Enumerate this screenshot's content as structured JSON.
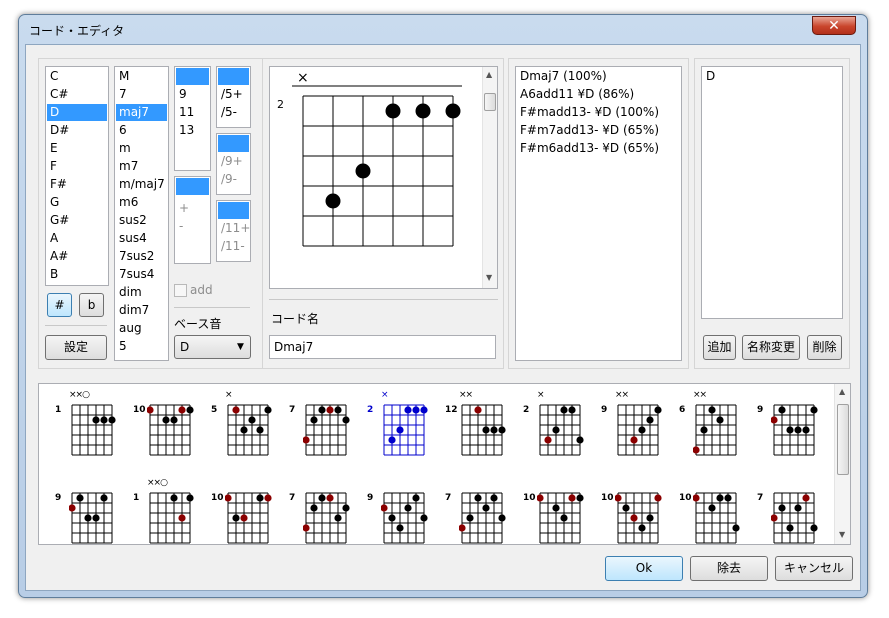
{
  "window": {
    "title": "コード・エディタ",
    "close_glyph": "✕"
  },
  "roots": [
    "C",
    "C#",
    "D",
    "D#",
    "E",
    "F",
    "F#",
    "G",
    "G#",
    "A",
    "A#",
    "B"
  ],
  "selected_root": 2,
  "qualities": [
    "M",
    "7",
    "maj7",
    "6",
    "m",
    "m7",
    "m/maj7",
    "m6",
    "sus2",
    "sus4",
    "7sus2",
    "7sus4",
    "dim",
    "dim7",
    "aug",
    "5"
  ],
  "selected_quality": 2,
  "tensions": [
    "",
    "9",
    "11",
    "13"
  ],
  "fifth_mod": [
    "+",
    "-"
  ],
  "slash5": [
    "",
    "/5+",
    "/5-"
  ],
  "slash9": [
    "",
    "/9+",
    "/9-"
  ],
  "slash11": [
    "",
    "/11+",
    "/11-"
  ],
  "sharp_btn": "#",
  "flat_btn": "b",
  "settings_btn": "設定",
  "add_label": "add",
  "bass_label": "ベース音",
  "bass_value": "D",
  "chord_name_label": "コード名",
  "chord_name_value": "Dmaj7",
  "candidates": [
    "Dmaj7 (100%)",
    "A6add11 ¥D (86%)",
    "F#madd13- ¥D (100%)",
    "F#m7add13- ¥D (65%)",
    "F#m6add13- ¥D (65%)"
  ],
  "names_list": [
    "D"
  ],
  "add_btn": "追加",
  "rename_btn": "名称変更",
  "delete_btn": "削除",
  "ok_btn": "Ok",
  "remove_btn": "除去",
  "cancel_btn": "キャンセル",
  "colors": {
    "accent": "#3399ff",
    "root_dot": "#8b0000",
    "selected_diagram": "#0000cc"
  },
  "main_diagram": {
    "fret": "2",
    "markers": [
      "×",
      "",
      "",
      "",
      "",
      ""
    ],
    "dots": [
      {
        "string": 2,
        "fret": 4
      },
      {
        "string": 3,
        "fret": 3
      },
      {
        "string": 4,
        "fret": 1
      },
      {
        "string": 5,
        "fret": 1
      },
      {
        "string": 6,
        "fret": 1
      }
    ]
  },
  "diagrams": [
    {
      "fret": "1",
      "m": "××○",
      "dots": [
        [
          4,
          2
        ],
        [
          5,
          2
        ],
        [
          6,
          2
        ]
      ],
      "red": [],
      "sel": false
    },
    {
      "fret": "10",
      "m": "",
      "dots": [
        [
          1,
          1
        ],
        [
          3,
          2
        ],
        [
          4,
          2
        ],
        [
          5,
          1
        ],
        [
          6,
          1
        ]
      ],
      "red": [
        [
          1,
          1
        ],
        [
          5,
          1
        ]
      ],
      "sel": false
    },
    {
      "fret": "5",
      "m": "×",
      "dots": [
        [
          2,
          1
        ],
        [
          3,
          3
        ],
        [
          4,
          2
        ],
        [
          5,
          3
        ],
        [
          6,
          1
        ]
      ],
      "red": [
        [
          2,
          1
        ]
      ],
      "sel": false
    },
    {
      "fret": "7",
      "m": "",
      "dots": [
        [
          1,
          4
        ],
        [
          2,
          2
        ],
        [
          3,
          1
        ],
        [
          4,
          1
        ],
        [
          5,
          1
        ],
        [
          6,
          2
        ]
      ],
      "red": [
        [
          1,
          4
        ],
        [
          4,
          1
        ]
      ],
      "sel": false
    },
    {
      "fret": "2",
      "m": "×",
      "dots": [
        [
          2,
          4
        ],
        [
          3,
          3
        ],
        [
          4,
          1
        ],
        [
          5,
          1
        ],
        [
          6,
          1
        ]
      ],
      "red": [],
      "sel": true
    },
    {
      "fret": "12",
      "m": "××",
      "dots": [
        [
          3,
          1
        ],
        [
          4,
          3
        ],
        [
          5,
          3
        ],
        [
          6,
          3
        ]
      ],
      "red": [
        [
          3,
          1
        ]
      ],
      "sel": false
    },
    {
      "fret": "2",
      "m": "×",
      "dots": [
        [
          2,
          4
        ],
        [
          3,
          3
        ],
        [
          4,
          1
        ],
        [
          5,
          1
        ],
        [
          6,
          4
        ]
      ],
      "red": [
        [
          2,
          4
        ]
      ],
      "sel": false
    },
    {
      "fret": "9",
      "m": "××",
      "dots": [
        [
          3,
          4
        ],
        [
          4,
          3
        ],
        [
          5,
          2
        ],
        [
          6,
          1
        ]
      ],
      "red": [
        [
          3,
          4
        ]
      ],
      "sel": false
    },
    {
      "fret": "6",
      "m": "××",
      "dots": [
        [
          1,
          5
        ],
        [
          2,
          3
        ],
        [
          3,
          1
        ],
        [
          4,
          2
        ]
      ],
      "red": [
        [
          1,
          5
        ]
      ],
      "sel": false
    },
    {
      "fret": "9",
      "m": "",
      "dots": [
        [
          1,
          2
        ],
        [
          2,
          1
        ],
        [
          3,
          3
        ],
        [
          4,
          3
        ],
        [
          5,
          3
        ],
        [
          6,
          1
        ]
      ],
      "red": [
        [
          1,
          2
        ]
      ],
      "sel": false
    },
    {
      "fret": "9",
      "m": "",
      "dots": [
        [
          1,
          2
        ],
        [
          2,
          1
        ],
        [
          3,
          3
        ],
        [
          4,
          3
        ],
        [
          5,
          1
        ]
      ],
      "red": [
        [
          1,
          2
        ]
      ],
      "sel": false
    },
    {
      "fret": "1",
      "m": "××○",
      "dots": [
        [
          4,
          1
        ],
        [
          5,
          3
        ],
        [
          6,
          1
        ]
      ],
      "red": [
        [
          5,
          3
        ]
      ],
      "sel": false
    },
    {
      "fret": "10",
      "m": "",
      "dots": [
        [
          1,
          1
        ],
        [
          2,
          3
        ],
        [
          3,
          3
        ],
        [
          5,
          1
        ],
        [
          6,
          1
        ]
      ],
      "red": [
        [
          1,
          1
        ],
        [
          3,
          3
        ],
        [
          6,
          1
        ]
      ],
      "sel": false
    },
    {
      "fret": "7",
      "m": "",
      "dots": [
        [
          1,
          4
        ],
        [
          2,
          2
        ],
        [
          3,
          1
        ],
        [
          4,
          1
        ],
        [
          5,
          3
        ],
        [
          6,
          2
        ]
      ],
      "red": [
        [
          1,
          4
        ],
        [
          4,
          1
        ]
      ],
      "sel": false
    },
    {
      "fret": "9",
      "m": "",
      "dots": [
        [
          1,
          2
        ],
        [
          2,
          3
        ],
        [
          3,
          4
        ],
        [
          4,
          2
        ],
        [
          5,
          1
        ],
        [
          6,
          3
        ]
      ],
      "red": [
        [
          1,
          2
        ]
      ],
      "sel": false
    },
    {
      "fret": "7",
      "m": "",
      "dots": [
        [
          1,
          4
        ],
        [
          2,
          3
        ],
        [
          3,
          1
        ],
        [
          4,
          2
        ],
        [
          5,
          1
        ],
        [
          6,
          3
        ]
      ],
      "red": [
        [
          1,
          4
        ]
      ],
      "sel": false
    },
    {
      "fret": "10",
      "m": "",
      "dots": [
        [
          1,
          1
        ],
        [
          3,
          2
        ],
        [
          4,
          3
        ],
        [
          5,
          1
        ],
        [
          6,
          1
        ]
      ],
      "red": [
        [
          1,
          1
        ],
        [
          5,
          1
        ]
      ],
      "sel": false
    },
    {
      "fret": "10",
      "m": "",
      "dots": [
        [
          1,
          1
        ],
        [
          2,
          2
        ],
        [
          3,
          3
        ],
        [
          4,
          4
        ],
        [
          5,
          3
        ],
        [
          6,
          1
        ]
      ],
      "red": [
        [
          1,
          1
        ],
        [
          3,
          3
        ],
        [
          6,
          1
        ]
      ],
      "sel": false
    },
    {
      "fret": "10",
      "m": "",
      "dots": [
        [
          1,
          1
        ],
        [
          3,
          2
        ],
        [
          4,
          1
        ],
        [
          5,
          1
        ],
        [
          6,
          4
        ]
      ],
      "red": [
        [
          1,
          1
        ]
      ],
      "sel": false
    },
    {
      "fret": "7",
      "m": "",
      "dots": [
        [
          1,
          3
        ],
        [
          2,
          2
        ],
        [
          3,
          4
        ],
        [
          4,
          2
        ],
        [
          5,
          1
        ],
        [
          6,
          4
        ]
      ],
      "red": [
        [
          1,
          3
        ],
        [
          5,
          1
        ]
      ],
      "sel": false
    }
  ]
}
